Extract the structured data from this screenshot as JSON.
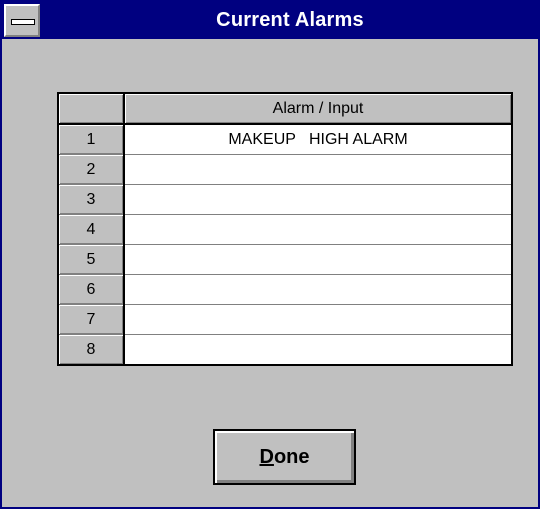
{
  "window": {
    "title": "Current Alarms"
  },
  "table": {
    "column_header": "Alarm / Input",
    "rows": [
      {
        "num": "1",
        "value": "MAKEUP   HIGH ALARM"
      },
      {
        "num": "2",
        "value": ""
      },
      {
        "num": "3",
        "value": ""
      },
      {
        "num": "4",
        "value": ""
      },
      {
        "num": "5",
        "value": ""
      },
      {
        "num": "6",
        "value": ""
      },
      {
        "num": "7",
        "value": ""
      },
      {
        "num": "8",
        "value": ""
      }
    ]
  },
  "buttons": {
    "done_mnemonic": "D",
    "done_rest": "one"
  },
  "icons": {
    "system_menu": "system-menu-icon"
  },
  "colors": {
    "titlebar": "#000080",
    "face": "#c0c0c0"
  }
}
